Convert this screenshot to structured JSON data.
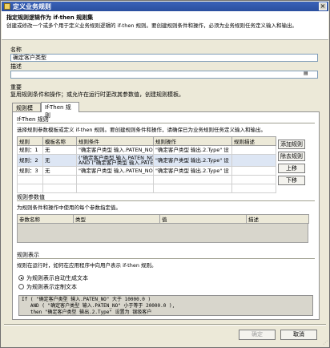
{
  "window": {
    "title": "定义业务规则"
  },
  "header": {
    "title": "指定规则逻辑作为 if-then 规则集",
    "description": "创建或修改一个或多个用于定义业务规则逻辑的 if-then 规则。要创建规则条件和操作，必须为业务规则任务定义输入和输出。"
  },
  "form": {
    "name_label": "名称",
    "name_value": "确定客户类型",
    "desc_label": "描述",
    "desc_value": "",
    "importance_label": "重要",
    "importance_text": "复用规则条件和操作；或允许在运行时更改其参数值，创建规则模板。"
  },
  "tabs": [
    {
      "label": "规则模板",
      "active": false
    },
    {
      "label": "If-Then 规则",
      "active": true
    }
  ],
  "rules_section": {
    "title": "If-Then 规则",
    "description": "选择规则参数模板或定义 if-then 规则。要创建规则条件和操作，请确保已为业务规则任务定义输入和输出。",
    "columns": [
      "规则",
      "模板名称",
      "规则条件",
      "规则操作",
      "规则描述"
    ],
    "rows": [
      {
        "rule": "规则：1",
        "template": "无",
        "condition": "\"确定客户类型 输入.PATEN_NO\" 大于 1000",
        "action": "\"确定客户类型 输出.2.Type\" 设",
        "desc": ""
      },
      {
        "rule": "规则：2",
        "template": "无",
        "condition": "(\"确定客户类型 输入.PATEN_NO\"",
        "condition2": "AND (\"确定客户类型 输入.PATE",
        "action": "\"确定客户类型 输出.2.Type\" 设",
        "desc": ""
      },
      {
        "rule": "规则：3",
        "template": "无",
        "condition": "\"确定客户类型 输入.PATEN_NO\" 小",
        "action": "\"确定客户类型 输出.2.Type\" 设",
        "desc": ""
      }
    ],
    "selected_row": 1,
    "buttons": {
      "add": "添加规则",
      "remove": "除去规则",
      "up": "上移",
      "down": "下移"
    }
  },
  "params_section": {
    "title": "规则参数值",
    "description": "为规则条件和操作中使用的每个参数指定值。",
    "columns": [
      "参数名称",
      "类型",
      "值",
      "描述"
    ]
  },
  "display_section": {
    "title": "规则表示",
    "description": "规则在运行时，如何在应用程序中向用户表示 if-then 规则。",
    "options": [
      {
        "label": "为规则表示自动生成文本",
        "selected": true
      },
      {
        "label": "为规则表示定制文本",
        "selected": false
      }
    ],
    "text_lines": [
      "If ( \"确定客户类型 输入.PATEN_NO\" 大于 10000.0 )",
      "   AND ( \"确定客户类型 输入.PATEN_NO\" 小于等于 20000.0 ),",
      "   then \"确定客户类型 输出.2.Type\" 设置为 银级客户"
    ]
  },
  "footer": {
    "ok": "确定",
    "cancel": "取消"
  }
}
